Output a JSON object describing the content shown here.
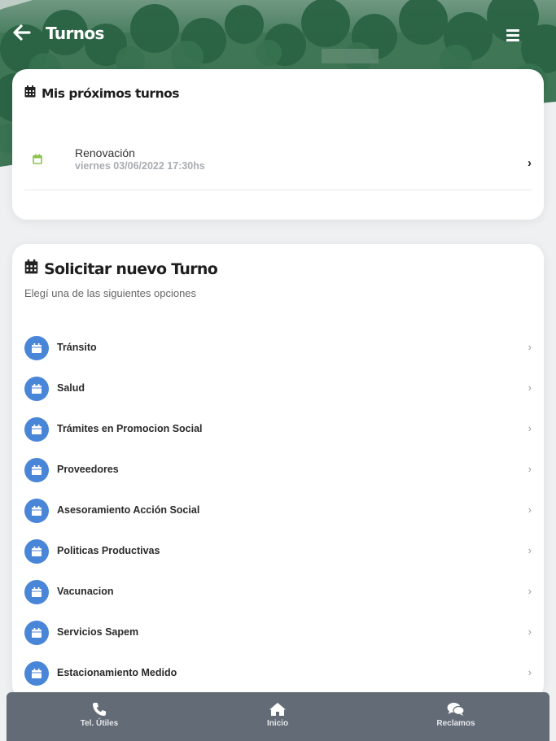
{
  "header": {
    "title": "Turnos"
  },
  "upcoming": {
    "title": "Mis próximos turnos",
    "items": [
      {
        "name": "Renovación",
        "date": "viernes 03/06/2022 17:30hs"
      }
    ]
  },
  "new_appointment": {
    "title": "Solicitar nuevo Turno",
    "subtitle": "Elegí una de las siguientes opciones",
    "options": [
      {
        "label": "Tránsito"
      },
      {
        "label": "Salud"
      },
      {
        "label": "Trámites en Promocion Social"
      },
      {
        "label": "Proveedores"
      },
      {
        "label": "Asesoramiento Acción Social"
      },
      {
        "label": "Politicas Productivas"
      },
      {
        "label": "Vacunacion"
      },
      {
        "label": "Servicios Sapem"
      },
      {
        "label": "Estacionamiento Medido"
      }
    ]
  },
  "bottom_nav": {
    "items": [
      {
        "label": "Tel. Útiles",
        "icon": "phone-icon"
      },
      {
        "label": "Inicio",
        "icon": "home-icon"
      },
      {
        "label": "Reclamos",
        "icon": "chat-icon"
      }
    ]
  },
  "colors": {
    "accent_blue": "#4a86d8",
    "green_icon": "#8bc34a",
    "nav_bg": "#636c76",
    "header_green": "#2f6e4e"
  }
}
